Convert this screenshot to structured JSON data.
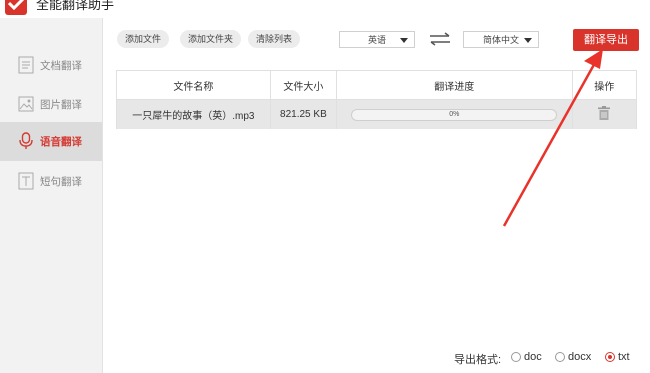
{
  "app": {
    "title": "全能翻译助手"
  },
  "sidebar": {
    "items": [
      {
        "label": "文档翻译",
        "icon": "document-icon",
        "active": false
      },
      {
        "label": "图片翻译",
        "icon": "image-icon",
        "active": false
      },
      {
        "label": "语音翻译",
        "icon": "microphone-icon",
        "active": true
      },
      {
        "label": "短句翻译",
        "icon": "text-icon",
        "active": false
      }
    ]
  },
  "toolbar": {
    "add_file": "添加文件",
    "add_folder": "添加文件夹",
    "clear_list": "清除列表",
    "source_lang": "英语",
    "target_lang": "简体中文",
    "export_label": "翻译导出"
  },
  "table": {
    "headers": [
      "文件名称",
      "文件大小",
      "翻译进度",
      "操作"
    ],
    "rows": [
      {
        "name": "一只犀牛的故事（英）.mp3",
        "size": "821.25 KB",
        "progress_text": "0%",
        "progress": 0
      }
    ]
  },
  "export_format": {
    "label": "导出格式:",
    "options": [
      {
        "label": "doc",
        "selected": false
      },
      {
        "label": "docx",
        "selected": false
      },
      {
        "label": "txt",
        "selected": true
      }
    ]
  },
  "colors": {
    "accent": "#d9342b",
    "annotation_arrow": "#e8322a"
  }
}
